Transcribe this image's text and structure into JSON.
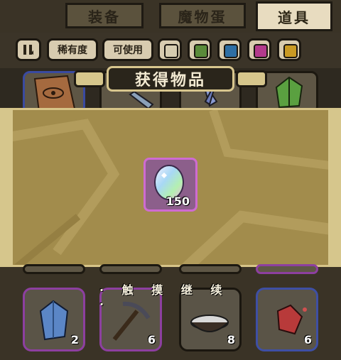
{
  "tabs": [
    {
      "label": "装备"
    },
    {
      "label": "魔物蛋"
    },
    {
      "label": "道具"
    }
  ],
  "filters": {
    "toggle_icon": "pause-sort-icon",
    "rarity_label": "稀有度",
    "usable_label": "可使用",
    "colors": [
      "#d6ccb0",
      "#5a8b3a",
      "#2e6fa4",
      "#b33a8c",
      "#c99a23"
    ]
  },
  "popup": {
    "title": "获得物品",
    "reward": {
      "icon": "rainbow-crystal-egg-icon",
      "count": "150"
    }
  },
  "continue_text": "· 触 摸 继 续 ·",
  "bottom_items": [
    {
      "icon": "blue-crystal-icon",
      "qty": "2",
      "frame": "#8d3fa0"
    },
    {
      "icon": "pickaxe-icon",
      "qty": "6",
      "frame": "#8d3fa0"
    },
    {
      "icon": "powder-bowl-icon",
      "qty": "8",
      "frame": "#5c5648"
    },
    {
      "icon": "red-gem-icon",
      "qty": "6",
      "frame": "#3e4fa4"
    }
  ]
}
